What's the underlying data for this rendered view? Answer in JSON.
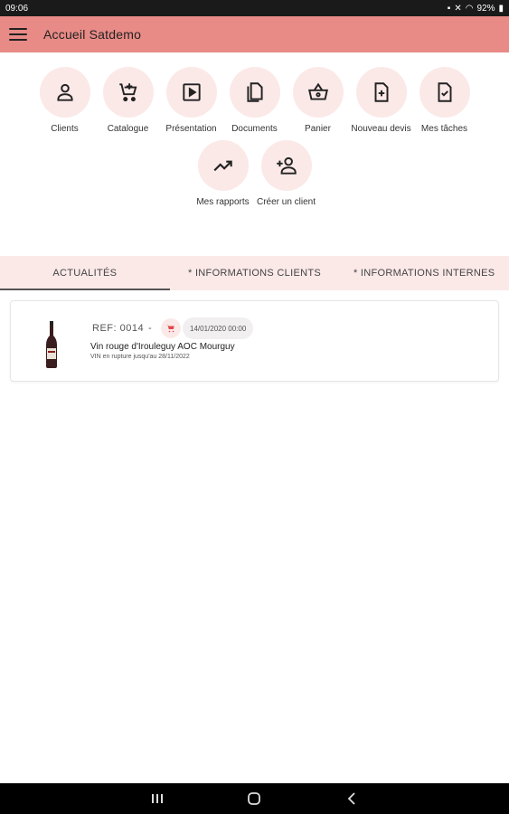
{
  "status_bar": {
    "time": "09:06",
    "battery": "92%"
  },
  "app_bar": {
    "title": "Accueil  Satdemo"
  },
  "actions": {
    "clients": "Clients",
    "catalogue": "Catalogue",
    "presentation": "Présentation",
    "documents": "Documents",
    "panier": "Panier",
    "nouveau_devis": "Nouveau devis",
    "mes_taches": "Mes tâches",
    "mes_rapports": "Mes rapports",
    "creer_client": "Créer un client"
  },
  "tabs": {
    "actualites": "ACTUALITÉS",
    "infos_clients": "* INFORMATIONS CLIENTS",
    "infos_internes": "* INFORMATIONS INTERNES"
  },
  "news": {
    "ref": "REF: 0014",
    "separator": "-",
    "date": "14/01/2020 00:00",
    "name": "Vin rouge d'Irouleguy AOC Mourguy",
    "note": "VIN en rupture jusqu'au 28/11/2022"
  },
  "colors": {
    "accent": "#e88a86",
    "accent_light": "#fbe9e8"
  }
}
